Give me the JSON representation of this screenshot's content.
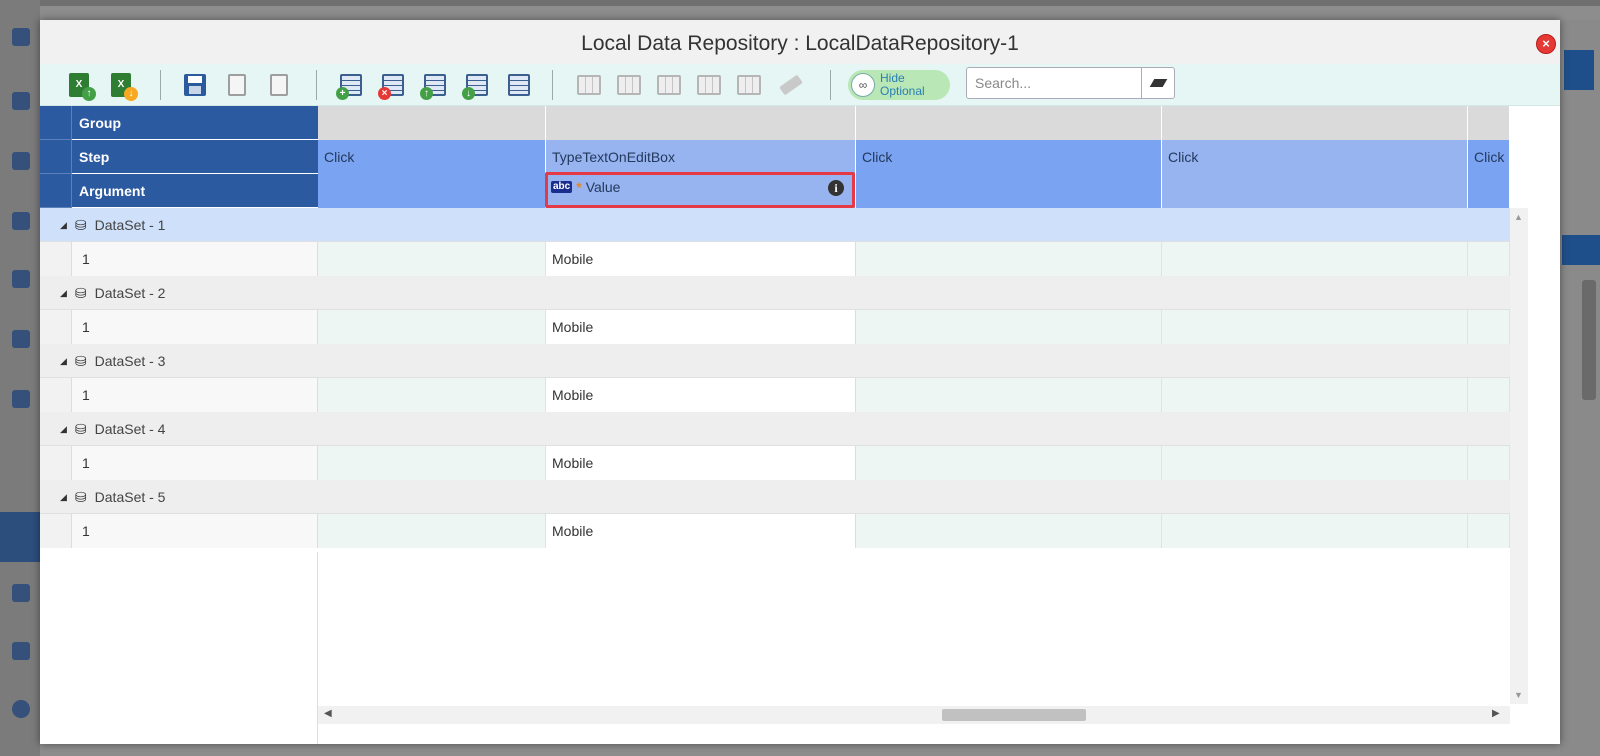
{
  "window": {
    "title": "Local Data Repository : LocalDataRepository-1",
    "close_label": "×"
  },
  "toolbar": {
    "hide_optional_label": "Hide Optional",
    "search_placeholder": "Search...",
    "search_value": ""
  },
  "grid": {
    "header_labels": {
      "group": "Group",
      "step": "Step",
      "argument": "Argument"
    },
    "steps": [
      "Click",
      "TypeTextOnEditBox",
      "Click",
      "Click",
      "Click"
    ],
    "argument": {
      "type_badge": "abc",
      "required_marker": "*",
      "name": "Value",
      "info_icon": "i"
    },
    "datasets": [
      {
        "label": "DataSet - 1",
        "row_index": "1",
        "value": "Mobile"
      },
      {
        "label": "DataSet - 2",
        "row_index": "1",
        "value": "Mobile"
      },
      {
        "label": "DataSet - 3",
        "row_index": "1",
        "value": "Mobile"
      },
      {
        "label": "DataSet - 4",
        "row_index": "1",
        "value": "Mobile"
      },
      {
        "label": "DataSet - 5",
        "row_index": "1",
        "value": "Mobile"
      }
    ]
  },
  "colors": {
    "header_dark": "#2c5aa0",
    "header_light": "#7aa3f2",
    "highlight_border": "#e53945",
    "toolbar_bg": "#e5f6f4"
  }
}
